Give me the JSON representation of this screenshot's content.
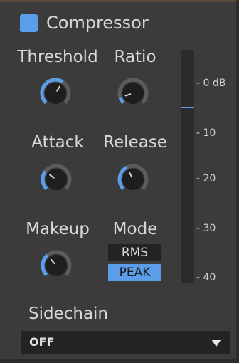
{
  "plugin": {
    "title": "Compressor",
    "enabled": true,
    "accent_color": "#5b9de8"
  },
  "knobs": {
    "threshold": {
      "label": "Threshold",
      "value": 0.62
    },
    "ratio": {
      "label": "Ratio",
      "value": 0.1
    },
    "attack": {
      "label": "Attack",
      "value": 0.3
    },
    "release": {
      "label": "Release",
      "value": 0.4
    },
    "makeup": {
      "label": "Makeup",
      "value": 0.35
    }
  },
  "mode": {
    "label": "Mode",
    "options": [
      "RMS",
      "PEAK"
    ],
    "selected": "PEAK"
  },
  "meter": {
    "scale_labels": [
      "- 0 dB",
      "- 10",
      "- 20",
      "- 30",
      "- 40"
    ],
    "level_db": -5
  },
  "sidechain": {
    "label": "Sidechain",
    "value": "OFF",
    "arrow_icon": "triangle-down-icon"
  }
}
